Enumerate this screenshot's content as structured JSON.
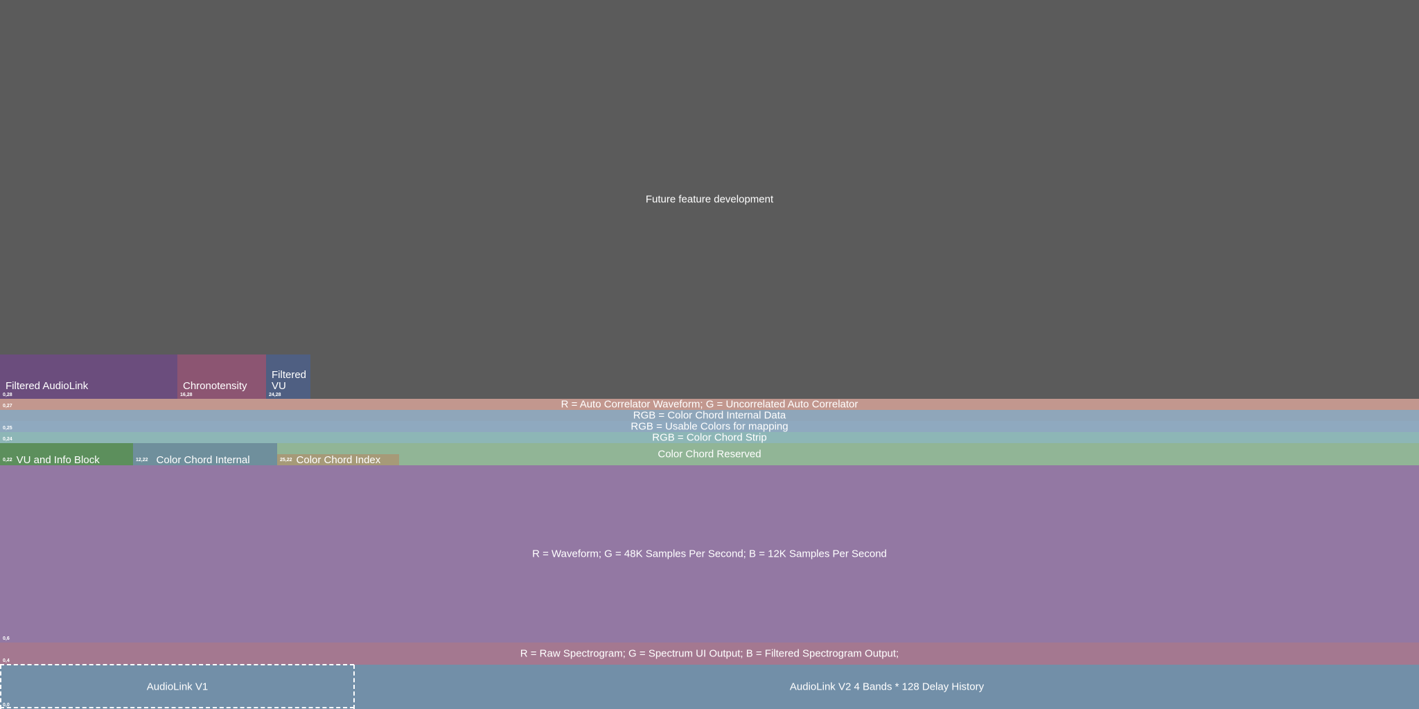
{
  "future": {
    "label": "Future feature development"
  },
  "filtered_audiolink": {
    "label": "Filtered AudioLink",
    "coord": "0,28"
  },
  "chronotensity": {
    "label": "Chronotensity",
    "coord": "16,28"
  },
  "filtered_vu": {
    "label_line1": "Filtered",
    "label_line2": "VU",
    "coord": "24,28"
  },
  "autocorrelator": {
    "label": "R = Auto Correlator Waveform; G = Uncorrelated Auto Correlator",
    "coord": "0,27"
  },
  "cc_internal_data": {
    "label": "RGB = Color Chord Internal Data"
  },
  "usable_colors": {
    "label": "RGB = Usable Colors for mapping",
    "coord": "0,25"
  },
  "cc_strip": {
    "label": "RGB = Color Chord Strip",
    "coord": "0,24"
  },
  "cc_reserved": {
    "label": "Color Chord Reserved"
  },
  "vu_info": {
    "label": "VU and Info Block",
    "coord": "0,22"
  },
  "cc_internal": {
    "label": "Color Chord Internal",
    "coord": "12,22"
  },
  "cc_index": {
    "label": "Color Chord Index",
    "coord": "25,22"
  },
  "waveform": {
    "label": "R = Waveform; G = 48K Samples Per Second; B = 12K Samples Per Second",
    "coord": "0,6"
  },
  "spectrogram": {
    "label": "R = Raw Spectrogram; G = Spectrum UI Output; B = Filtered Spectrogram Output;",
    "coord": "0,4"
  },
  "audiolink_v1": {
    "label": "AudioLink V1",
    "coord": "0,0"
  },
  "audiolink_v2": {
    "label": "AudioLink V2 4 Bands * 128 Delay History"
  },
  "colors": {
    "future": "#5b5b5b",
    "filtered_audiolink": "#6b4d7d",
    "chronotensity": "#8c5572",
    "filtered_vu": "#4f5f82",
    "autocorrelator": "#c2978e",
    "cc_internal_data": "#8fa6ba",
    "usable_colors": "#8fa9bf",
    "cc_strip": "#8db6b6",
    "cc_reserved": "#91b596",
    "vu_info": "#5c8f5c",
    "cc_internal": "#6f8f9c",
    "cc_index": "#a69a78",
    "waveform": "#9378a3",
    "spectrogram": "#a47890",
    "audiolink": "#728fa8"
  }
}
